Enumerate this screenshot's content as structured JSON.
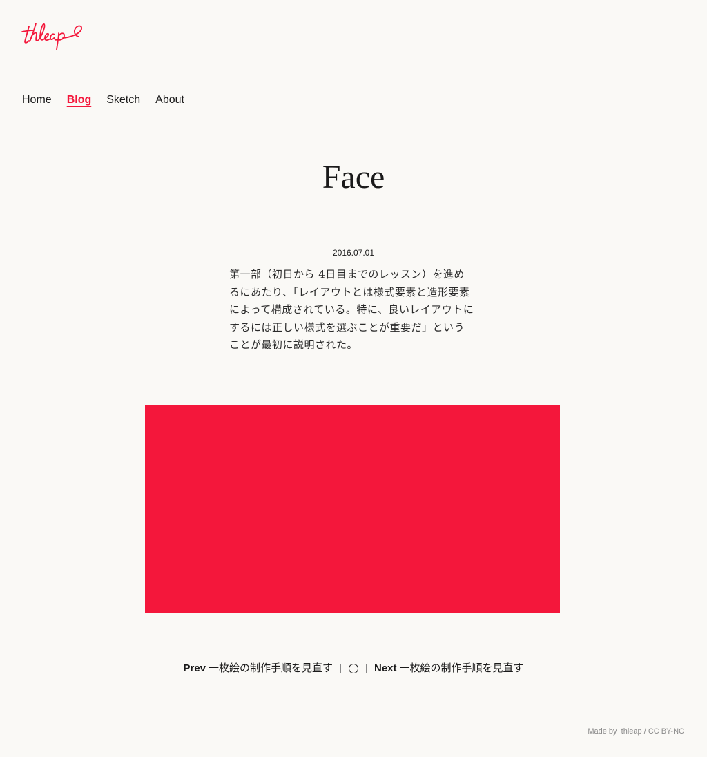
{
  "site": {
    "logo_text": "thleap",
    "brand_color": "#f4173b",
    "background_color": "#faf9f6"
  },
  "nav": {
    "items": [
      {
        "label": "Home",
        "active": false
      },
      {
        "label": "Blog",
        "active": true
      },
      {
        "label": "Sketch",
        "active": false
      },
      {
        "label": "About",
        "active": false
      }
    ]
  },
  "post": {
    "title": "Face",
    "date": "2016.07.01",
    "excerpt": "第一部（初日から 4日目までのレッスン）を進めるにあたり、「レイアウトとは様式要素と造形要素によって構成されている。特に、良いレイアウトにするには正しい様式を選ぶことが重要だ」ということが最初に説明された。",
    "hero_color": "#f4173b"
  },
  "pager": {
    "prev_label": "Prev",
    "prev_title": "一枚絵の制作手順を見直す",
    "index_icon": "circle-icon",
    "next_label": "Next",
    "next_title": "一枚絵の制作手順を見直す"
  },
  "footer": {
    "made_by_label": "Made by",
    "author": "thleap",
    "separator": "/",
    "license": "CC BY-NC"
  }
}
